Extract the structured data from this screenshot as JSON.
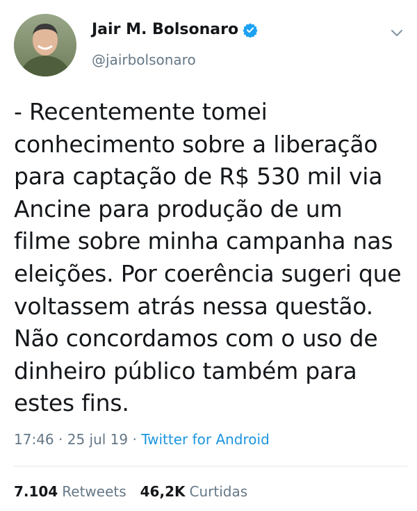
{
  "author": {
    "display_name": "Jair M. Bolsonaro",
    "handle": "@jairbolsonaro",
    "verified": true
  },
  "tweet": {
    "text": "- Recentemente tomei\nconhecimento sobre a liberação\npara captação de R$ 530 mil via\nAncine para produção de um\nfilme sobre minha campanha nas\neleições. Por coerência sugeri que\nvoltassem atrás nessa questão.\nNão concordamos com o uso de\ndinheiro público também para\nestes fins.",
    "time": "17:46",
    "date": "25 jul 19",
    "separator": " · ",
    "source": "Twitter for Android"
  },
  "stats": {
    "retweets_count": "7.104",
    "retweets_label": "Retweets",
    "likes_count": "46,2K",
    "likes_label": "Curtidas"
  },
  "icons": {
    "verified": "verified-badge-icon",
    "menu": "chevron-down-icon"
  },
  "colors": {
    "link": "#1b95e0",
    "verified": "#1da1f2",
    "secondary_text": "#657786"
  }
}
